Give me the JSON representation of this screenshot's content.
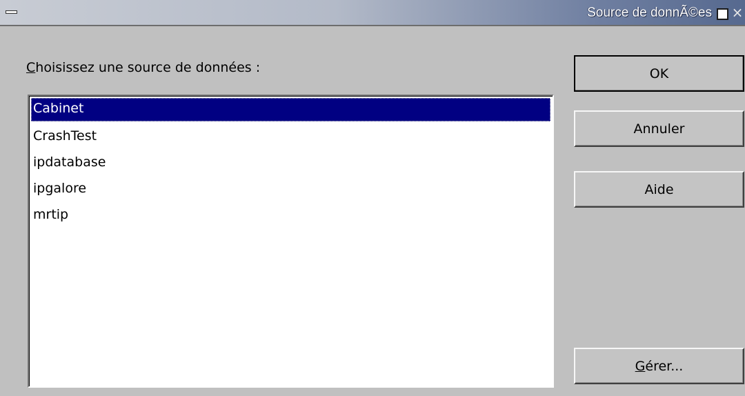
{
  "window": {
    "title": "Source de donnÃ©es",
    "menu_icon": "window-menu-icon",
    "maximize_icon": "maximize-icon",
    "close_icon": "close-icon",
    "close_glyph": "×"
  },
  "dialog": {
    "prompt_mnemonic": "C",
    "prompt_rest": "hoisissez une source de données :",
    "datasources": [
      {
        "label": "Cabinet",
        "selected": true
      },
      {
        "label": "CrashTest",
        "selected": false
      },
      {
        "label": "ipdatabase",
        "selected": false
      },
      {
        "label": "ipgalore",
        "selected": false
      },
      {
        "label": "mrtip",
        "selected": false
      }
    ],
    "buttons": {
      "ok": "OK",
      "cancel": "Annuler",
      "help": "Aide",
      "manage_mnemonic": "G",
      "manage_rest": "érer..."
    }
  },
  "colors": {
    "selection_bg": "#010082",
    "selection_fg": "#ffffff",
    "window_bg": "#c0c0c0"
  }
}
